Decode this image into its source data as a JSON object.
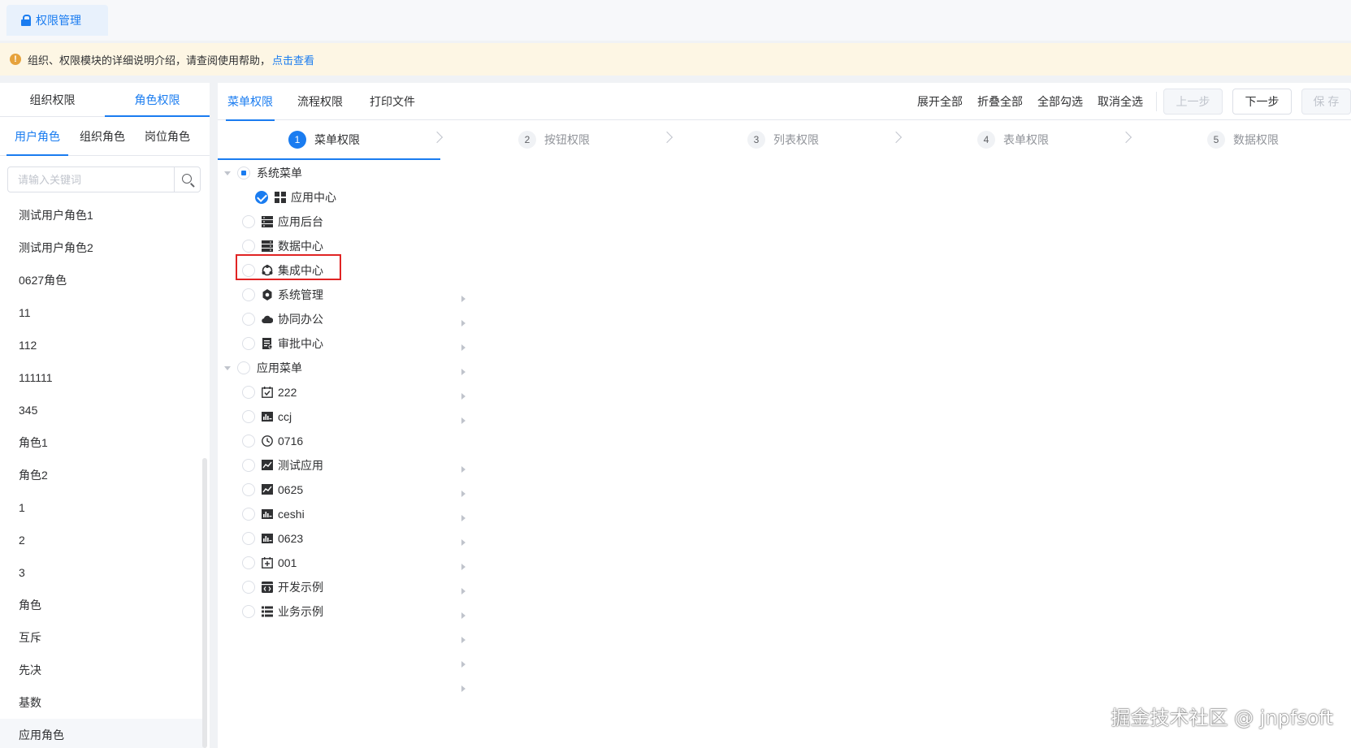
{
  "top_tab": {
    "label": "权限管理"
  },
  "notice": {
    "text": "组织、权限模块的详细说明介绍，请查阅使用帮助，",
    "link": "点击查看"
  },
  "left_tabs": [
    "组织权限",
    "角色权限"
  ],
  "left_subtabs": [
    "用户角色",
    "组织角色",
    "岗位角色"
  ],
  "search": {
    "placeholder": "请输入关键词"
  },
  "roles": [
    "测试用户角色1",
    "测试用户角色2",
    "0627角色",
    "11",
    "112",
    "111111",
    "345",
    "角色1",
    "角色2",
    "1",
    "2",
    "3",
    "角色",
    "互斥",
    "先决",
    "基数",
    "应用角色"
  ],
  "right_tabs": [
    "菜单权限",
    "流程权限",
    "打印文件"
  ],
  "actions": [
    "展开全部",
    "折叠全部",
    "全部勾选",
    "取消全选"
  ],
  "buttons": {
    "prev": "上一步",
    "next": "下一步",
    "save": "保 存"
  },
  "steps": [
    {
      "num": "1",
      "label": "菜单权限"
    },
    {
      "num": "2",
      "label": "按钮权限"
    },
    {
      "num": "3",
      "label": "列表权限"
    },
    {
      "num": "4",
      "label": "表单权限"
    },
    {
      "num": "5",
      "label": "数据权限"
    }
  ],
  "tree": {
    "system_root": "系统菜单",
    "system_items": [
      {
        "label": "应用中心",
        "icon": "grid-icon",
        "checked": true
      },
      {
        "label": "应用后台",
        "icon": "server-icon"
      },
      {
        "label": "数据中心",
        "icon": "database-icon"
      },
      {
        "label": "集成中心",
        "icon": "integration-icon"
      },
      {
        "label": "系统管理",
        "icon": "gear-icon"
      },
      {
        "label": "协同办公",
        "icon": "cloud-icon"
      },
      {
        "label": "审批中心",
        "icon": "approval-icon"
      }
    ],
    "app_root": "应用菜单",
    "app_items": [
      {
        "label": "222",
        "icon": "calendar-check-icon"
      },
      {
        "label": "ccj",
        "icon": "chart-doc-icon"
      },
      {
        "label": "0716",
        "icon": "clock-icon"
      },
      {
        "label": "测试应用",
        "icon": "line-chart-icon"
      },
      {
        "label": "0625",
        "icon": "line-chart-icon"
      },
      {
        "label": "ceshi",
        "icon": "chart-doc-icon"
      },
      {
        "label": "0623",
        "icon": "chart-doc-icon"
      },
      {
        "label": "001",
        "icon": "calendar-plus-icon"
      },
      {
        "label": "开发示例",
        "icon": "code-icon"
      },
      {
        "label": "业务示例",
        "icon": "list-icon"
      }
    ]
  },
  "watermark": "掘金技术社区 @ jnpfsoft",
  "colors": {
    "primary": "#1a7cf0",
    "warning": "#e6a23c",
    "highlight": "#e02424"
  }
}
